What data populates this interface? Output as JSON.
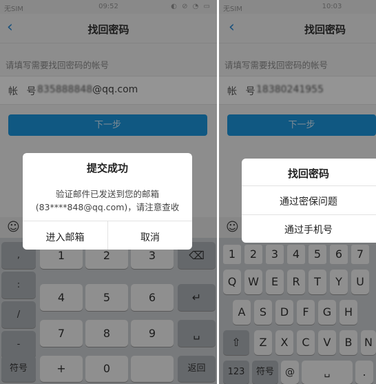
{
  "left": {
    "status": {
      "carrier": "无SIM",
      "time": "09:52",
      "icons": "◐ ⊘ ◔ ▭"
    },
    "nav": {
      "back": "‹",
      "title": "找回密码"
    },
    "hint": "请填写需要找回密码的帐号",
    "account": {
      "label": "帐 号",
      "value_blurred": "835888848",
      "value_suffix": "@qq.com"
    },
    "next_button": "下一步",
    "keyboard": {
      "toolbar_icon": "☺",
      "side_keys": [
        ",",
        ":",
        "/",
        "-"
      ],
      "rows": [
        [
          "1",
          "2",
          "3"
        ],
        [
          "4",
          "5",
          "6"
        ],
        [
          "7",
          "8",
          "9"
        ],
        [
          "+",
          "0",
          ""
        ]
      ],
      "right_keys": [
        "⌫",
        "↵",
        "␣"
      ],
      "symbols": "符号",
      "return": "返回"
    },
    "dialog": {
      "title": "提交成功",
      "message_line1": "验证邮件已发送到您的邮箱",
      "message_line2": "(83****848@qq.com)，请注意查收",
      "confirm": "进入邮箱",
      "cancel": "取消"
    }
  },
  "right": {
    "status": {
      "carrier": "无SIM",
      "time": "10:03"
    },
    "nav": {
      "back": "‹",
      "title": "找回密码"
    },
    "hint": "请填写需要找回密码的帐号",
    "account": {
      "label": "帐 号",
      "value_blurred": "18380241955"
    },
    "next_button": "下一步",
    "keyboard": {
      "toolbar_icon": "☺",
      "num_row": [
        "1",
        "2",
        "3",
        "4",
        "5",
        "6",
        "7"
      ],
      "row1": [
        "Q",
        "W",
        "E",
        "R",
        "T",
        "Y",
        "U"
      ],
      "row2": [
        "A",
        "S",
        "D",
        "F",
        "G",
        "H"
      ],
      "row3": [
        "Z",
        "X",
        "C",
        "V",
        "B",
        "N"
      ],
      "shift": "⇧",
      "bottom": {
        "k123": "123",
        "sym": "符号",
        "at": "@",
        "space": "␣",
        "dot": "."
      }
    },
    "menu": {
      "title": "找回密码",
      "option1": "通过密保问题",
      "option2": "通过手机号"
    }
  }
}
